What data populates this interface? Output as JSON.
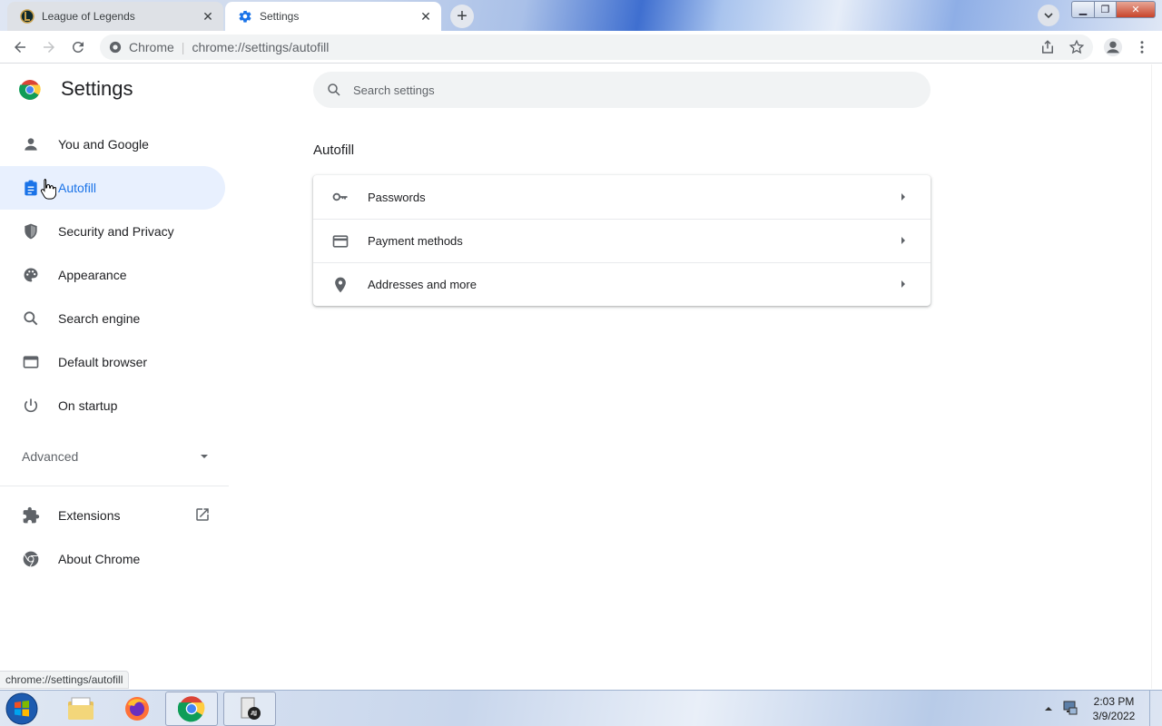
{
  "colors": {
    "accent": "#1a73e8",
    "selected_bg": "#e8f0fe",
    "text": "#202124",
    "muted": "#5f6368"
  },
  "tabs": [
    {
      "title": "League of Legends",
      "favicon": "league-of-legends-icon",
      "active": false
    },
    {
      "title": "Settings",
      "favicon": "gear-icon",
      "active": true
    }
  ],
  "toolbar": {
    "site_label": "Chrome",
    "url": "chrome://settings/autofill"
  },
  "settings": {
    "title": "Settings",
    "search_placeholder": "Search settings",
    "nav": {
      "items": [
        {
          "label": "You and Google",
          "icon": "person-icon"
        },
        {
          "label": "Autofill",
          "icon": "clipboard-icon",
          "selected": true
        },
        {
          "label": "Security and Privacy",
          "icon": "shield-icon"
        },
        {
          "label": "Appearance",
          "icon": "palette-icon"
        },
        {
          "label": "Search engine",
          "icon": "search-icon"
        },
        {
          "label": "Default browser",
          "icon": "browser-window-icon"
        },
        {
          "label": "On startup",
          "icon": "power-icon"
        }
      ],
      "advanced_label": "Advanced",
      "extensions_label": "Extensions",
      "about_label": "About Chrome"
    },
    "section": {
      "title": "Autofill",
      "rows": [
        {
          "label": "Passwords",
          "icon": "key-icon"
        },
        {
          "label": "Payment methods",
          "icon": "credit-card-icon"
        },
        {
          "label": "Addresses and more",
          "icon": "location-pin-icon"
        }
      ]
    }
  },
  "status_bar": {
    "text": "chrome://settings/autofill"
  },
  "taskbar": {
    "apps": [
      "windows-explorer-icon",
      "firefox-icon",
      "chrome-icon",
      "task-manager-icon"
    ],
    "time": "2:03 PM",
    "date": "3/9/2022"
  }
}
